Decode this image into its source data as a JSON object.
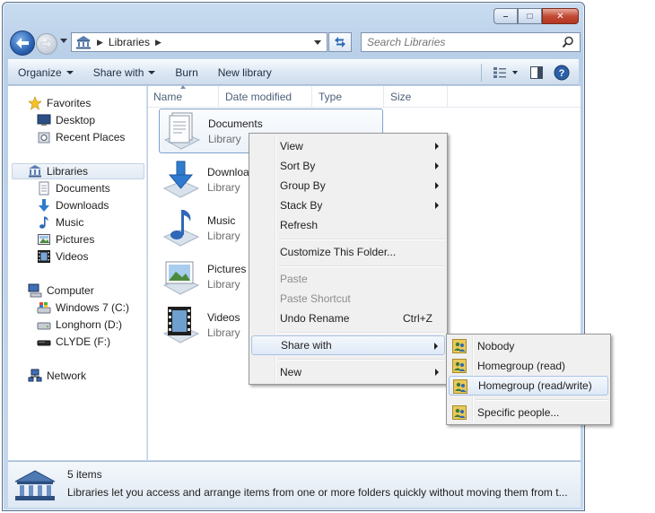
{
  "window": {
    "caption_buttons": {
      "minimize": "–",
      "maximize": "□",
      "close": "✕"
    }
  },
  "nav": {
    "address_crumb": "Libraries",
    "search_placeholder": "Search Libraries"
  },
  "toolbar": {
    "organize": "Organize",
    "share_with": "Share with",
    "burn": "Burn",
    "new_library": "New library"
  },
  "sidebar": {
    "favorites": {
      "label": "Favorites",
      "items": [
        "Desktop",
        "Recent Places"
      ]
    },
    "libraries": {
      "label": "Libraries",
      "items": [
        "Documents",
        "Downloads",
        "Music",
        "Pictures",
        "Videos"
      ]
    },
    "computer": {
      "label": "Computer",
      "items": [
        "Windows 7 (C:)",
        "Longhorn (D:)",
        "CLYDE (F:)"
      ]
    },
    "network": {
      "label": "Network"
    }
  },
  "columns": [
    "Name",
    "Date modified",
    "Type",
    "Size"
  ],
  "libraries": [
    {
      "name": "Documents",
      "type": "Library"
    },
    {
      "name": "Downloads",
      "type": "Library"
    },
    {
      "name": "Music",
      "type": "Library"
    },
    {
      "name": "Pictures",
      "type": "Library"
    },
    {
      "name": "Videos",
      "type": "Library"
    }
  ],
  "context_menu": {
    "view": "View",
    "sort_by": "Sort By",
    "group_by": "Group By",
    "stack_by": "Stack By",
    "refresh": "Refresh",
    "customize": "Customize This Folder...",
    "paste": "Paste",
    "paste_shortcut": "Paste Shortcut",
    "undo_rename": "Undo Rename",
    "undo_shortcut": "Ctrl+Z",
    "share_with": "Share with",
    "new": "New"
  },
  "share_submenu": {
    "nobody": "Nobody",
    "homegroup_read": "Homegroup (read)",
    "homegroup_readwrite": "Homegroup (read/write)",
    "specific_people": "Specific people..."
  },
  "details": {
    "count": "5 items",
    "description": "Libraries let you access and arrange items from one or more folders quickly without moving them from t..."
  }
}
